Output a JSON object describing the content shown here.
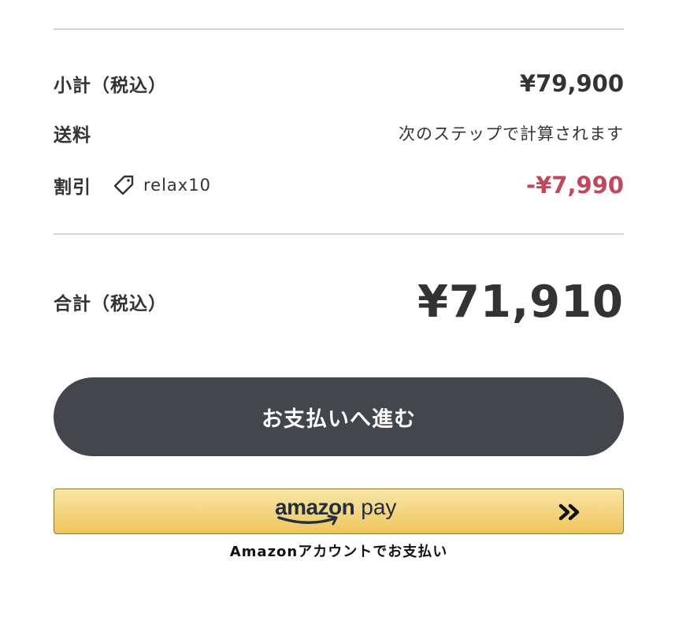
{
  "summary": {
    "subtotal_label": "小計（税込）",
    "subtotal_value": "¥79,900",
    "shipping_label": "送料",
    "shipping_value": "次のステップで計算されます",
    "discount_label": "割引",
    "coupon_icon": "tag-icon",
    "coupon_code": "relax10",
    "discount_value": "-¥7,990",
    "total_label": "合計（税込）",
    "total_value": "¥71,910"
  },
  "checkout": {
    "button_label": "お支払いへ進む"
  },
  "amazon_pay": {
    "logo_amazon": "amazon",
    "logo_pay": "pay",
    "arrow_icon": "double-chevron-right-icon",
    "caption": "Amazonアカウントでお支払い"
  },
  "colors": {
    "text": "#333333",
    "discount": "#c0475d",
    "checkout_button": "#43464d",
    "divider": "#d4d4d4",
    "amazon_button_top": "#f8e5a6",
    "amazon_button_bottom": "#eec65c"
  }
}
